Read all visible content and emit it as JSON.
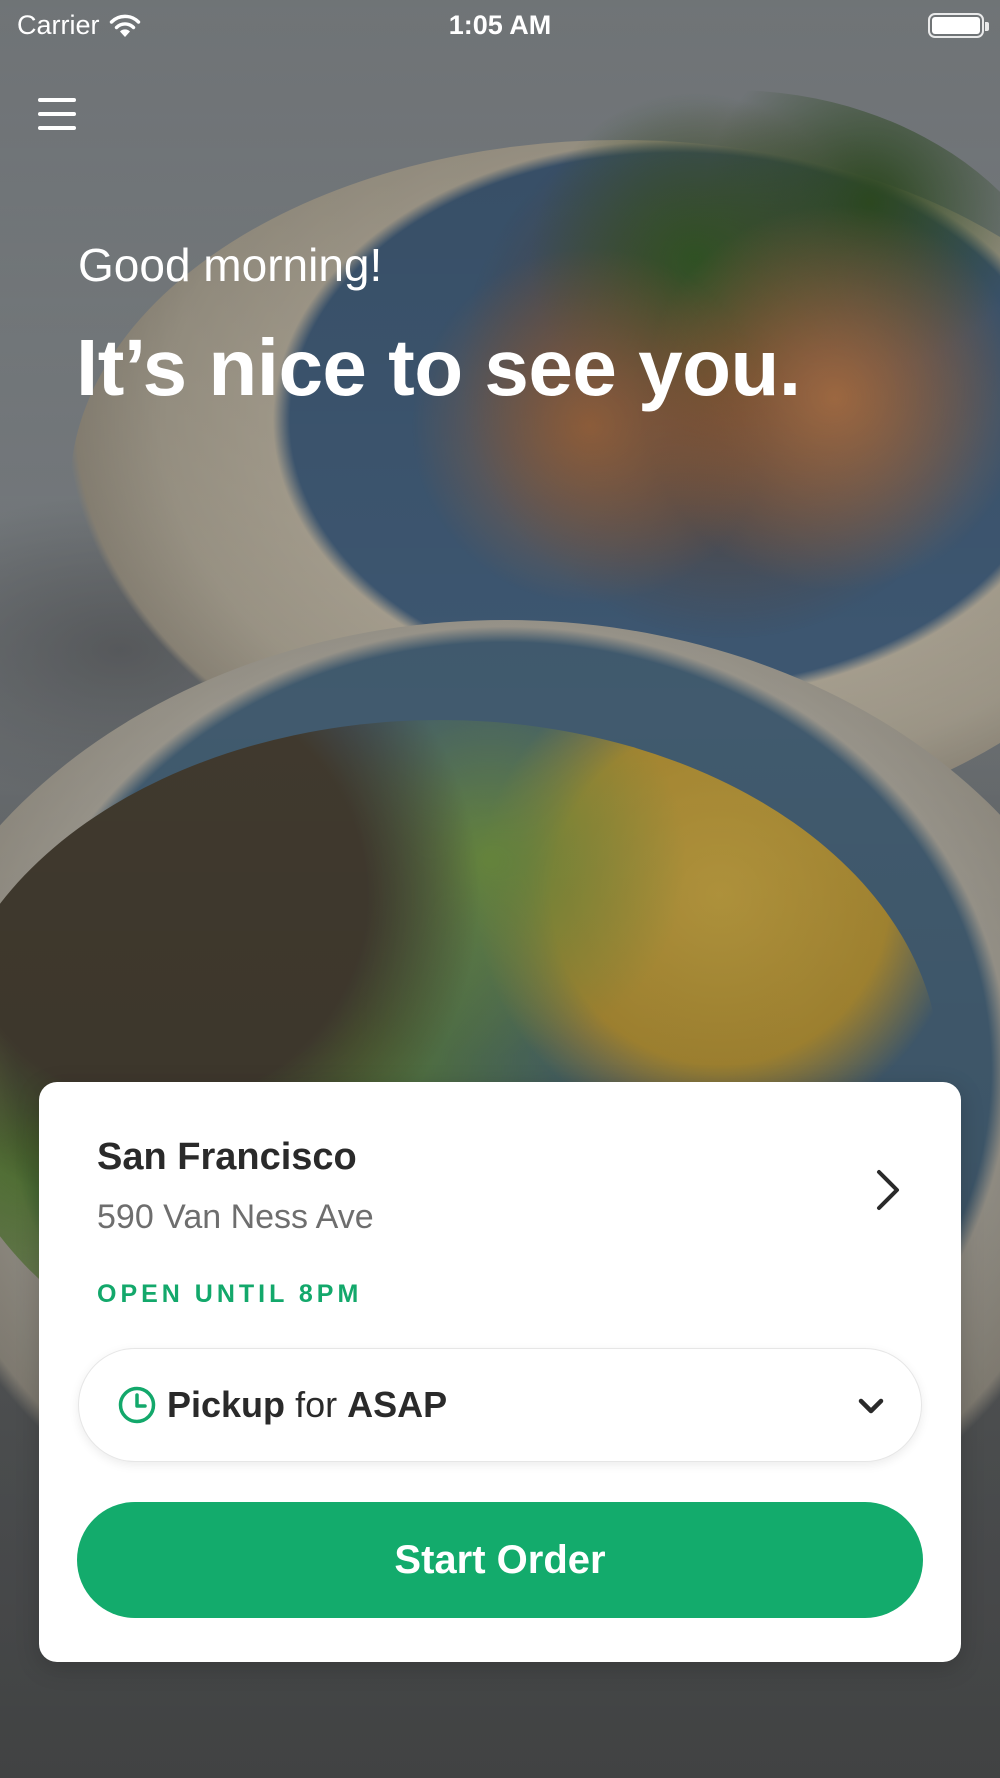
{
  "status_bar": {
    "carrier": "Carrier",
    "time": "1:05 AM",
    "wifi_icon": "wifi-icon",
    "battery_icon": "battery-icon"
  },
  "header": {
    "menu_icon": "hamburger-menu-icon"
  },
  "greeting": {
    "subtitle": "Good morning!",
    "title": "It’s nice to see you."
  },
  "card": {
    "location": {
      "city": "San Francisco",
      "address": "590 Van Ness Ave",
      "chevron_icon": "chevron-right-icon"
    },
    "status": "OPEN UNTIL 8PM",
    "pickup": {
      "icon": "clock-icon",
      "mode": "Pickup",
      "connector": "for",
      "time": "ASAP",
      "dropdown_icon": "chevron-down-icon"
    },
    "start_button_label": "Start Order"
  },
  "colors": {
    "accent": "#13ab6c",
    "status_text": "#13a86b",
    "card_background": "#ffffff",
    "primary_text": "#2a2a2a",
    "secondary_text": "#6e6e6e"
  }
}
